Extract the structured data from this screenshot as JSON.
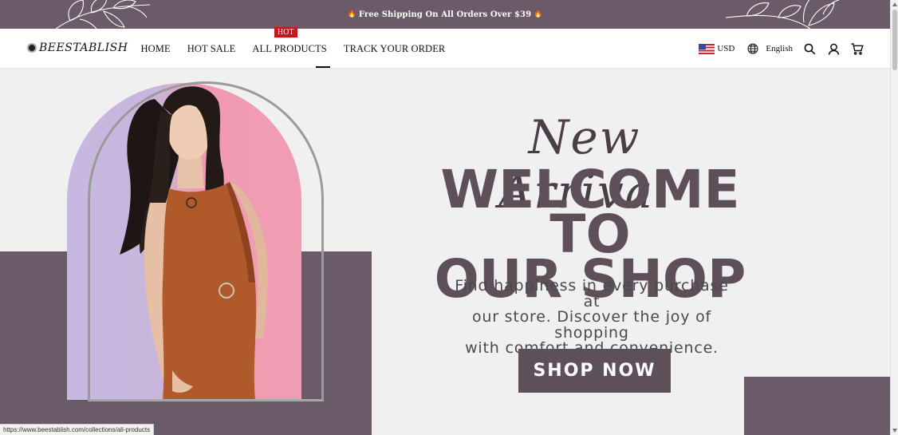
{
  "announcement": {
    "icon_left": "fire-icon",
    "text": "Free Shipping On All Orders Over $39",
    "icon_right": "fire-icon"
  },
  "header": {
    "logo_text": "BEESTABLISH",
    "nav": [
      {
        "label": "HOME"
      },
      {
        "label": "HOT SALE"
      },
      {
        "label": "ALL PRODUCTS",
        "badge": "HOT"
      },
      {
        "label": "TRACK YOUR ORDER"
      }
    ],
    "currency": "USD",
    "language": "English",
    "icons": [
      "us-flag-icon",
      "globe-icon",
      "search-icon",
      "user-icon",
      "cart-icon"
    ]
  },
  "hero": {
    "script_title": "New Arrival",
    "headline_line1": "WELCOME TO",
    "headline_line2": "OUR SHOP",
    "tagline_line1": "Find happiness in every purchase at",
    "tagline_line2": "our store. Discover the joy of shopping",
    "tagline_line3": "with comfort and convenience.",
    "cta": "SHOP NOW",
    "accent_color": "#6b5a67"
  },
  "status_bar": {
    "url": "https://www.beestablish.com/collections/all-products"
  }
}
